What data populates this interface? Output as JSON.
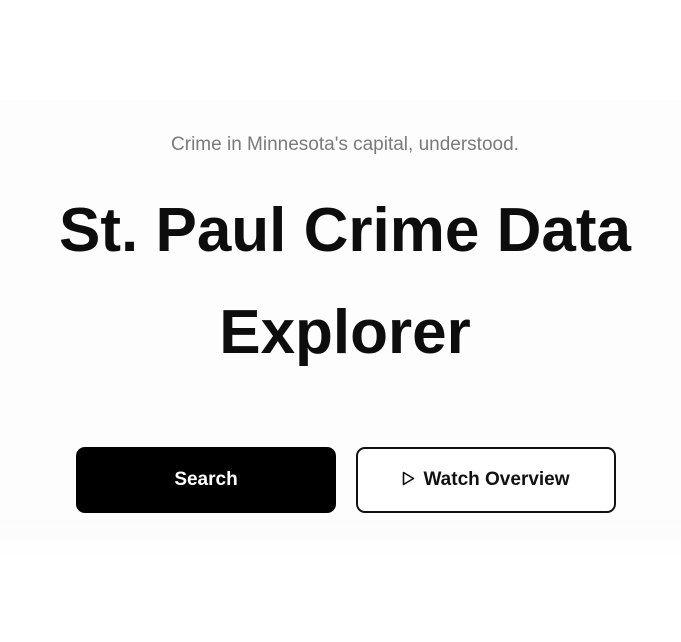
{
  "hero": {
    "tagline": "Crime in Minnesota's capital, understood.",
    "title_line1": "St. Paul Crime Data",
    "title_line2": "Explorer"
  },
  "actions": {
    "search_label": "Search",
    "watch_label": "Watch Overview",
    "watch_icon": "play-icon"
  },
  "colors": {
    "primary_button": "#000000",
    "secondary_border": "#111111",
    "tagline": "#7a7a7a"
  }
}
